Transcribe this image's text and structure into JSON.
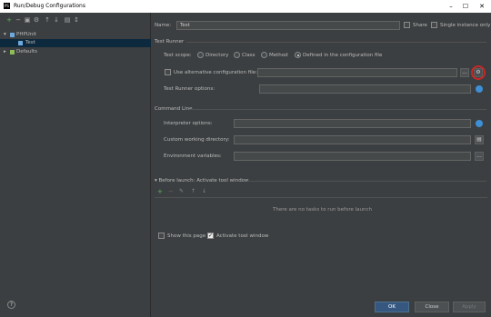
{
  "window": {
    "title": "Run/Debug Configurations",
    "logo": "PS",
    "min": "–",
    "max": "☐",
    "close": "✕"
  },
  "toolbar": {
    "icons": [
      "+",
      "−",
      "▣",
      "⚙",
      "↑",
      "↓",
      "▤",
      "↕"
    ]
  },
  "tree": {
    "group": "PHPUnit",
    "child": "Test",
    "defaults": "Defaults"
  },
  "form": {
    "name_label": "Name:",
    "name_value": "Test",
    "share_label": "Share",
    "single_instance_label": "Single instance only",
    "test_runner_header": "Test Runner",
    "test_scope_label": "Test scope:",
    "scope_options": [
      "Directory",
      "Class",
      "Method",
      "Defined in the configuration file"
    ],
    "alt_config_label": "Use alternative configuration file:",
    "runner_options_label": "Test Runner options:",
    "command_line_header": "Command Line",
    "interpreter_options_label": "Interpreter options:",
    "custom_dir_label": "Custom working directory:",
    "env_vars_label": "Environment variables:",
    "browse": "...",
    "before_launch_label": "Before launch: Activate tool window",
    "no_tasks_text": "There are no tasks to run before launch",
    "before_launch_tools": [
      "+",
      "−",
      "✎",
      "↑",
      "↓"
    ],
    "show_page_label": "Show this page",
    "activate_tool_label": "Activate tool window"
  },
  "buttons": {
    "ok": "OK",
    "close": "Close",
    "apply": "Apply",
    "help": "?"
  },
  "colors": {
    "accent": "#3d8fd6",
    "selection": "#0d293e",
    "highlight_ring": "#c62828"
  }
}
